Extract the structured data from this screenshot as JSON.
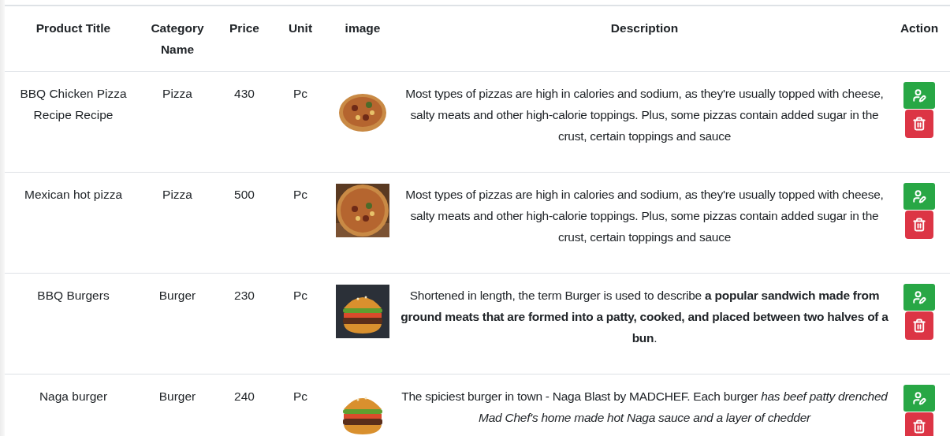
{
  "table": {
    "columns": [
      "Product Title",
      "Category Name",
      "Price",
      "Unit",
      "image",
      "Description",
      "Action"
    ],
    "rows": [
      {
        "title": "BBQ Chicken Pizza Recipe Recipe",
        "category": "Pizza",
        "price": "430",
        "unit": "Pc",
        "description": "Most types of pizzas are high in calories and sodium, as they're usually topped with cheese, salty meats and other high-calorie toppings. Plus, some pizzas contain added sugar in the crust, certain toppings and sauce"
      },
      {
        "title": "Mexican hot pizza",
        "category": "Pizza",
        "price": "500",
        "unit": "Pc",
        "description": "Most types of pizzas are high in calories and sodium, as they're usually topped with cheese, salty meats and other high-calorie toppings. Plus, some pizzas contain added sugar in the crust, certain toppings and sauce"
      },
      {
        "title": "BBQ Burgers",
        "category": "Burger",
        "price": "230",
        "unit": "Pc",
        "description": "Shortened in length, the term Burger is used to describe **a popular sandwich made from ground meats that are formed into a patty, cooked, and placed between two halves of a bun**."
      },
      {
        "title": "Naga burger",
        "category": "Burger",
        "price": "240",
        "unit": "Pc",
        "description": "The spiciest burger in town - Naga Blast by MADCHEF. Each burger *has beef patty drenched Mad Chef's home made hot Naga sauce and a layer of chedder*"
      }
    ]
  }
}
